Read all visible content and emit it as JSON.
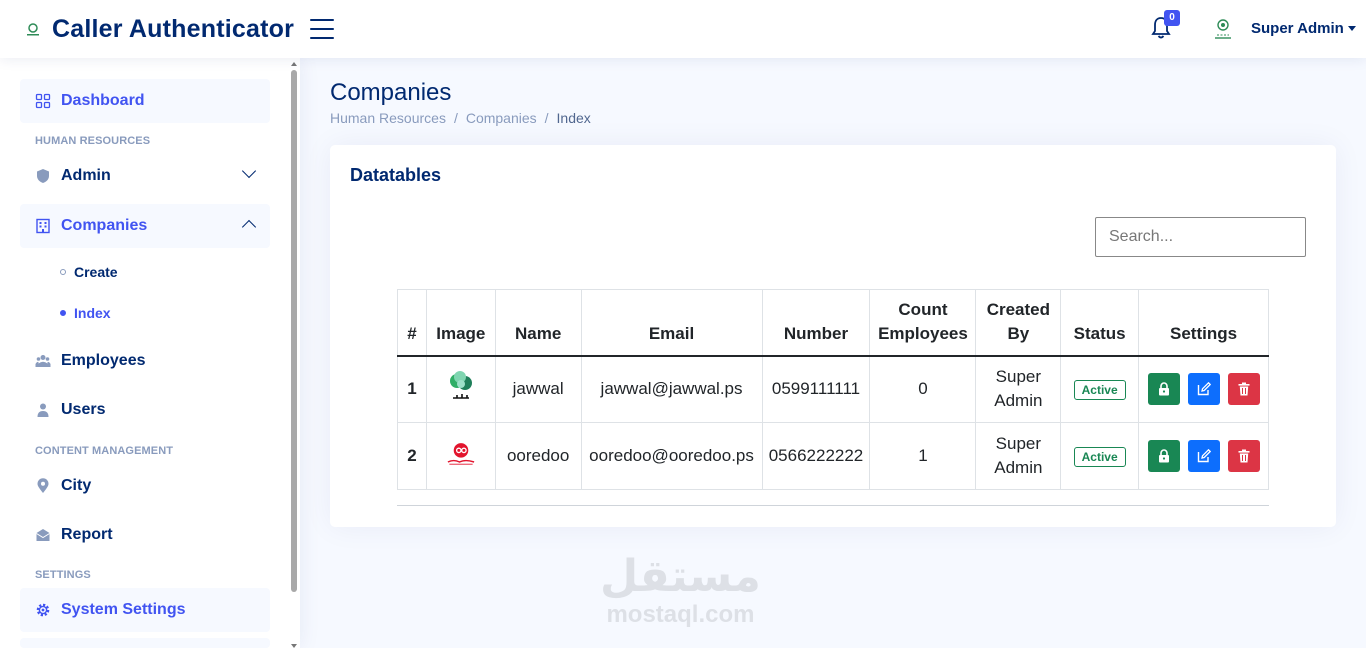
{
  "header": {
    "app_title": "Caller Authenticator",
    "notification_count": "0",
    "user_name": "Super Admin"
  },
  "sidebar": {
    "dashboard": "Dashboard",
    "section_hr": "HUMAN RESOURCES",
    "admin": "Admin",
    "companies": "Companies",
    "companies_sub": [
      {
        "label": "Create"
      },
      {
        "label": "Index"
      }
    ],
    "employees": "Employees",
    "users": "Users",
    "section_content": "CONTENT MANAGEMENT",
    "city": "City",
    "report": "Report",
    "section_settings": "SETTINGS",
    "system_settings": "System Settings"
  },
  "page": {
    "title": "Companies",
    "breadcrumb": [
      "Human Resources",
      "Companies",
      "Index"
    ]
  },
  "card": {
    "title": "Datatables",
    "search_placeholder": "Search..."
  },
  "table": {
    "headers": [
      "#",
      "Image",
      "Name",
      "Email",
      "Number",
      "Count Employees",
      "Created By",
      "Status",
      "Settings"
    ],
    "rows": [
      {
        "num": "1",
        "name": "jawwal",
        "email": "jawwal@jawwal.ps",
        "number": "0599111111",
        "count": "0",
        "created_by": "Super Admin",
        "status": "Active"
      },
      {
        "num": "2",
        "name": "ooredoo",
        "email": "ooredoo@ooredoo.ps",
        "number": "0566222222",
        "count": "1",
        "created_by": "Super Admin",
        "status": "Active"
      }
    ]
  },
  "watermark": {
    "arabic": "مستقل",
    "latin": "mostaql.com"
  },
  "colors": {
    "primary": "#012970",
    "accent": "#4154f1",
    "success": "#198754",
    "edit": "#0d6efd",
    "danger": "#dc3545"
  },
  "icons": [
    "menu-icon",
    "bell-icon",
    "avatar-icon",
    "grid-icon",
    "shield-icon",
    "building-icon",
    "people-icon",
    "person-icon",
    "geo-icon",
    "envelope-icon",
    "gear-icon",
    "lock-icon",
    "edit-icon",
    "trash-icon"
  ]
}
